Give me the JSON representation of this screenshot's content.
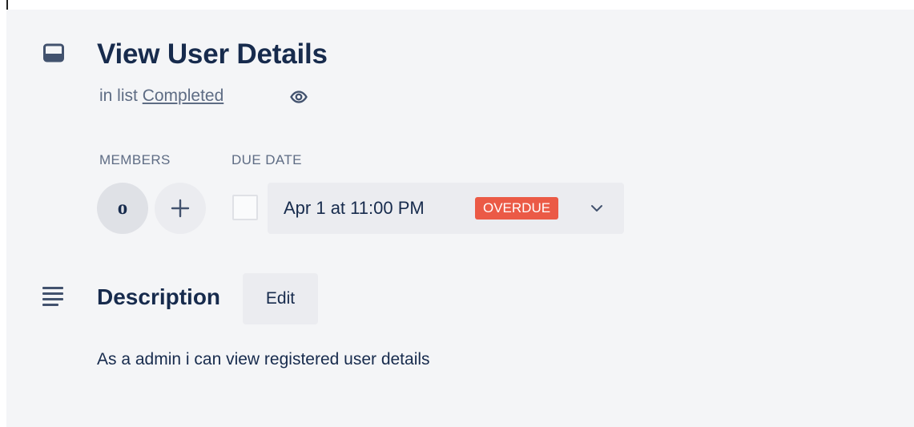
{
  "card": {
    "title": "View User Details",
    "in_list_prefix": "in list",
    "list_name": "Completed",
    "icon": "card-icon",
    "watch_icon": "eye-icon"
  },
  "members": {
    "label": "MEMBERS",
    "items": [
      {
        "initial": "o"
      }
    ],
    "add_icon": "plus-icon"
  },
  "due_date": {
    "label": "DUE DATE",
    "value": "Apr 1 at 11:00 PM",
    "badge": "OVERDUE",
    "badge_color": "#eb5a46",
    "dropdown_icon": "chevron-down-icon",
    "completed": false
  },
  "description": {
    "heading": "Description",
    "edit_label": "Edit",
    "text": "As a admin i can view registered user details",
    "icon": "description-lines-icon"
  },
  "colors": {
    "background": "#f4f5f7",
    "button": "#ebecf0",
    "text": "#172b4d",
    "muted": "#5e6c84"
  }
}
